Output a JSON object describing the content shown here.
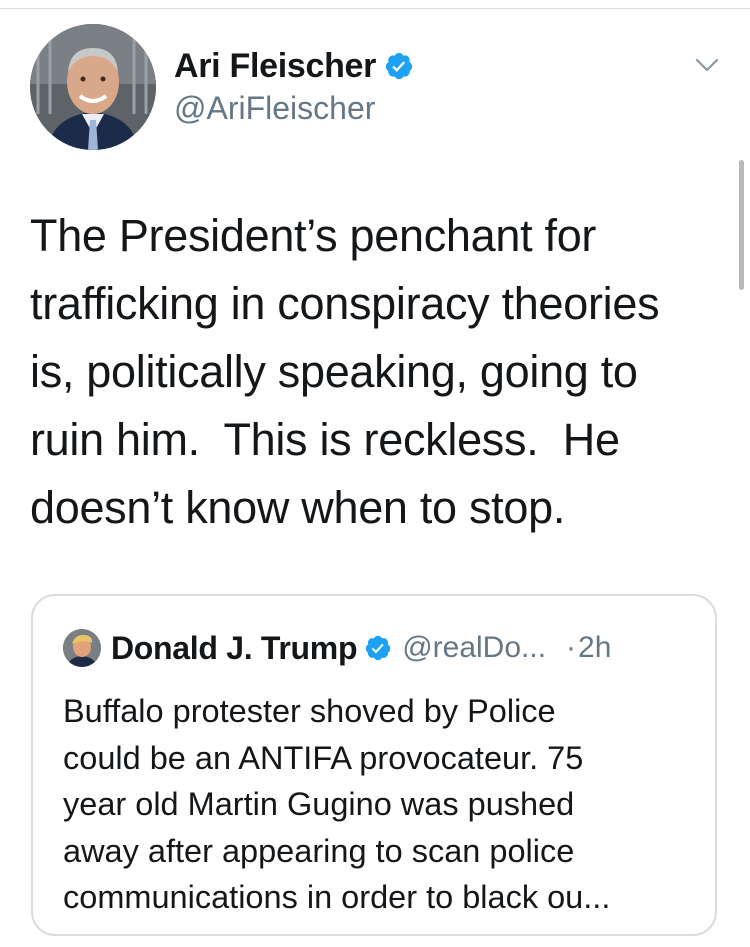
{
  "tweet": {
    "author": {
      "name": "Ari Fleischer",
      "handle": "@AriFleischer",
      "verified": true,
      "avatar_icon": "profile-photo"
    },
    "menu_icon": "chevron-down-icon",
    "text": "The President’s penchant for\ntrafficking in conspiracy theories\nis, politically speaking, going to\nruin him.  This is reckless.  He\ndoesn’t know when to stop.",
    "quoted_tweet": {
      "author": {
        "name": "Donald J. Trump",
        "handle": "@realDo...",
        "verified": true,
        "avatar_icon": "profile-photo"
      },
      "separator": "·",
      "time": "2h",
      "text": "Buffalo protester shoved by Police\ncould be an ANTIFA provocateur. 75\nyear old Martin Gugino was pushed\naway after appearing to scan police\ncommunications in order to black ou..."
    }
  },
  "colors": {
    "text_primary": "#14171a",
    "text_secondary": "#657786",
    "verified_blue": "#1da1f2",
    "border": "#d9dde0"
  }
}
